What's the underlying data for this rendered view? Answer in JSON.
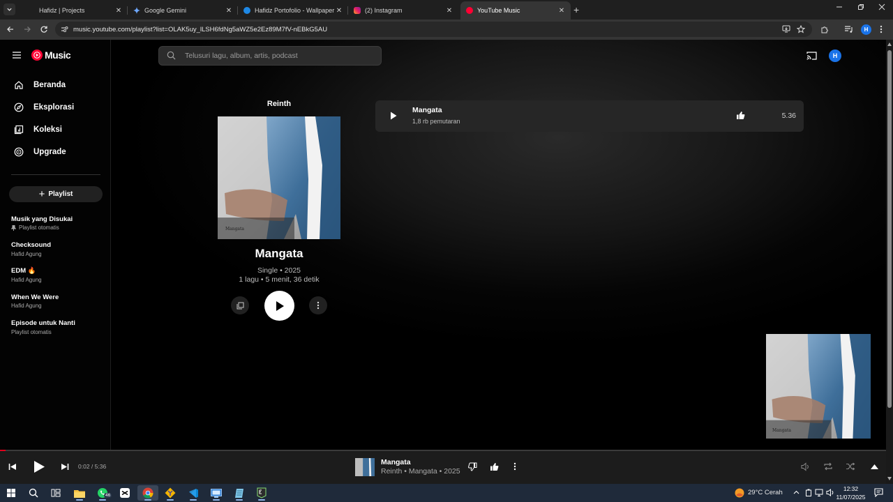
{
  "browser": {
    "tabs": [
      {
        "title": "Hafidz | Projects",
        "close": "✕"
      },
      {
        "title": "Google Gemini",
        "close": "✕"
      },
      {
        "title": "Hafidz Portofolio - Wallpaper D",
        "close": "✕"
      },
      {
        "title": "(2) Instagram",
        "close": "✕"
      },
      {
        "title": "YouTube Music",
        "close": "✕"
      }
    ],
    "new_tab": "+",
    "url": "music.youtube.com/playlist?list=OLAK5uy_lLSH6fdNg5aWZ5e2Ez89M7fV-nEBkG5AU",
    "profile_initial": "H"
  },
  "app": {
    "logo_text": "Music",
    "search_placeholder": "Telusuri lagu, album, artis, podcast",
    "avatar_initial": "H",
    "nav": [
      {
        "label": "Beranda",
        "icon": "home-icon"
      },
      {
        "label": "Eksplorasi",
        "icon": "compass-icon"
      },
      {
        "label": "Koleksi",
        "icon": "library-icon"
      },
      {
        "label": "Upgrade",
        "icon": "upgrade-icon"
      }
    ],
    "new_playlist_label": "Playlist",
    "playlists": [
      {
        "title": "Musik yang Disukai",
        "subtitle": "Playlist otomatis"
      },
      {
        "title": "Checksound",
        "subtitle": "Hafid Agung"
      },
      {
        "title": "EDM 🔥",
        "subtitle": "Hafid Agung"
      },
      {
        "title": "When We Were",
        "subtitle": "Hafid Agung"
      },
      {
        "title": "Episode untuk Nanti",
        "subtitle": "Playlist otomatis"
      }
    ],
    "album": {
      "artist": "Reinth",
      "cover_label": "Mangata",
      "title": "Mangata",
      "meta_type": "Single • 2025",
      "meta_info": "1 lagu • 5 menit, 36 detik"
    },
    "tracks": [
      {
        "title": "Mangata",
        "plays": "1,8 rb pemutaran",
        "duration": "5.36"
      }
    ]
  },
  "player": {
    "time": "0:02 / 5:36",
    "progress_fraction": 0.006,
    "title": "Mangata",
    "subtitle": "Reinth • Mangata • 2025",
    "cover_label": "Mangata"
  },
  "taskbar": {
    "whatsapp_badge": "46",
    "weather": "29°C  Cerah",
    "time": "12:32",
    "date": "11/07/2025"
  },
  "colors": {
    "brand_red": "#ff0033",
    "progress": "#e2001c",
    "avatar_blue": "#1a73e8"
  }
}
